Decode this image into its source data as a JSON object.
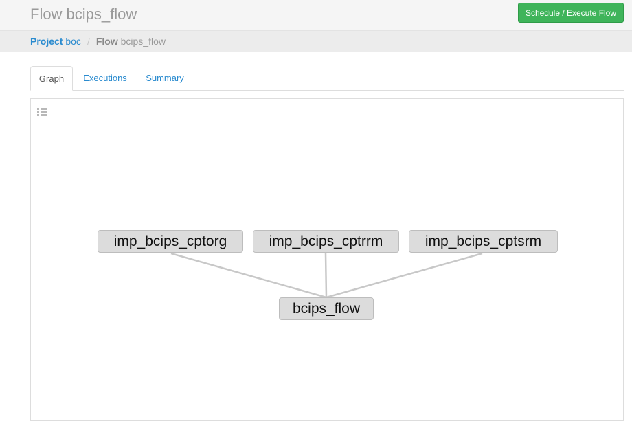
{
  "header": {
    "title": "Flow bcips_flow",
    "execute_button": "Schedule / Execute Flow"
  },
  "breadcrumb": {
    "project_label": "Project",
    "project_name": "boc",
    "separator": "/",
    "flow_label": "Flow",
    "flow_name": "bcips_flow"
  },
  "tabs": [
    {
      "label": "Graph",
      "active": true
    },
    {
      "label": "Executions",
      "active": false
    },
    {
      "label": "Summary",
      "active": false
    }
  ],
  "graph": {
    "toolbar_icon": "list-icon",
    "nodes": [
      {
        "id": "n1",
        "label": "imp_bcips_cptorg"
      },
      {
        "id": "n2",
        "label": "imp_bcips_cptrrm"
      },
      {
        "id": "n3",
        "label": "imp_bcips_cptsrm"
      },
      {
        "id": "n4",
        "label": "bcips_flow"
      }
    ],
    "edges": [
      {
        "from": "n1",
        "to": "n4"
      },
      {
        "from": "n2",
        "to": "n4"
      },
      {
        "from": "n3",
        "to": "n4"
      }
    ],
    "edge_color": "#c8c8c8"
  },
  "colors": {
    "accent": "#2a8bcf",
    "execute_button": "#3fb45a",
    "node_fill": "#dcdcdc"
  }
}
